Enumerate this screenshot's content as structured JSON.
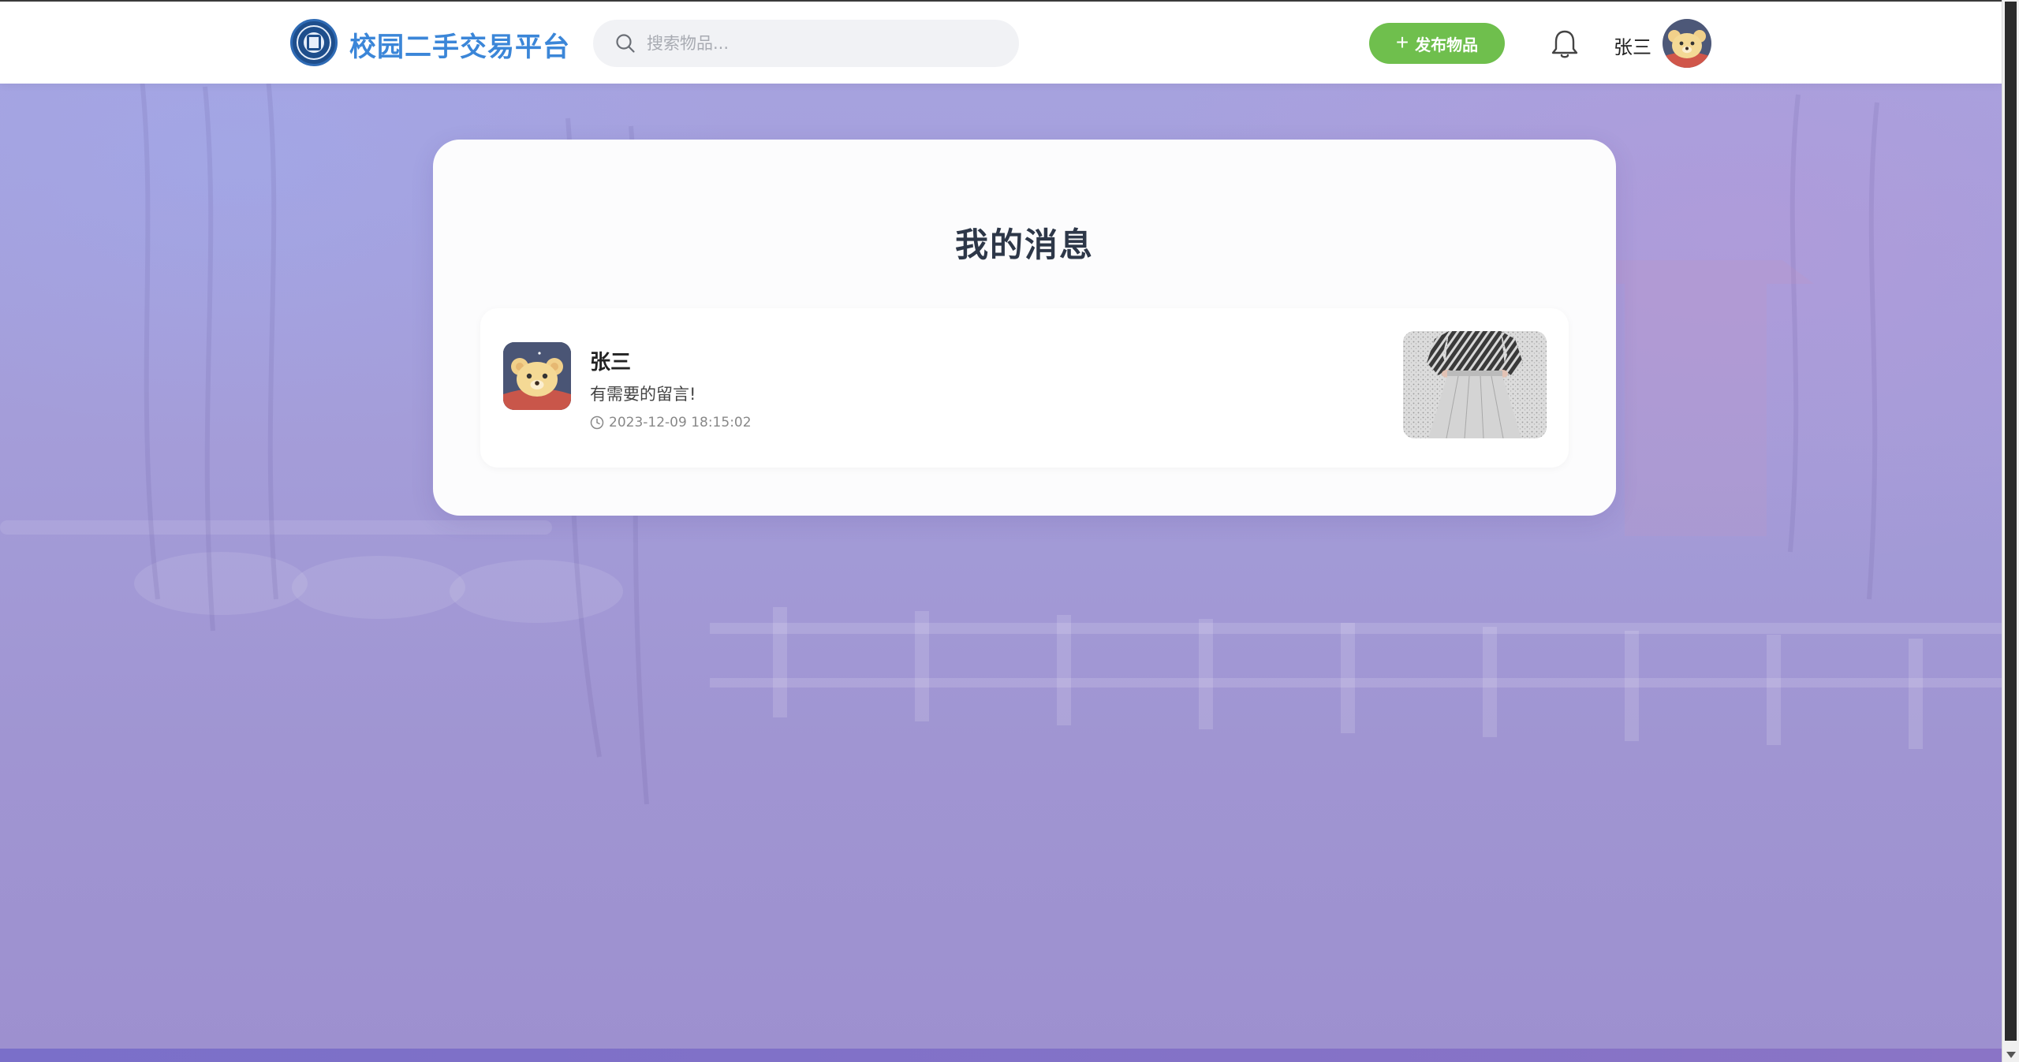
{
  "header": {
    "brand": "校园二手交易平台",
    "search_placeholder": "搜索物品...",
    "publish_label": "发布物品",
    "username": "张三",
    "icons": {
      "logo": "school-emblem-icon",
      "search": "search-icon",
      "publish": "plus-icon",
      "notifications": "bell-icon",
      "avatar": "bear-avatar"
    }
  },
  "page": {
    "title": "我的消息"
  },
  "messages": [
    {
      "sender": "张三",
      "content": "有需要的留言!",
      "time": "2023-12-09 18:15:02"
    }
  ],
  "colors": {
    "brand": "#3b86d8",
    "publish_button": "#6fbf4d",
    "title_text": "#2d3748"
  }
}
